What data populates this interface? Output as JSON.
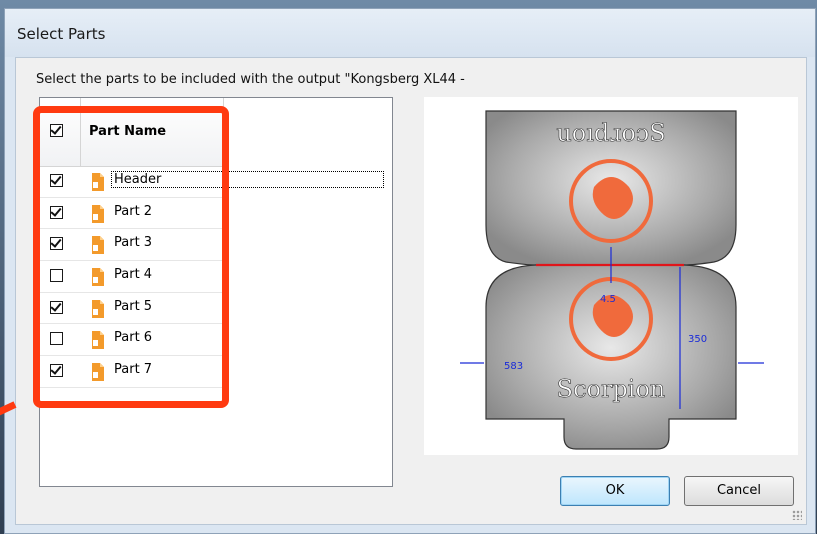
{
  "window": {
    "title": "Select Parts"
  },
  "instruction": "Select the parts to be included with the output \"Kongsberg  XL44 -",
  "list": {
    "header_checked": true,
    "column_header": "Part Name",
    "rows": [
      {
        "label": "Header",
        "checked": true,
        "focused": true
      },
      {
        "label": "Part 2",
        "checked": true
      },
      {
        "label": "Part 3",
        "checked": true
      },
      {
        "label": "Part 4",
        "checked": false
      },
      {
        "label": "Part 5",
        "checked": true
      },
      {
        "label": "Part 6",
        "checked": false
      },
      {
        "label": "Part 7",
        "checked": true
      }
    ]
  },
  "preview": {
    "top_logo_text": "uoıdɹoɔS",
    "bottom_logo_text": "Scorpion",
    "dimension_width": "583",
    "dimension_height": "350",
    "dimension_gap": "4.5"
  },
  "buttons": {
    "ok": "OK",
    "cancel": "Cancel"
  },
  "colors": {
    "highlight": "#ff3a10",
    "logo": "#f06a3c",
    "dimension": "#1a2bd8",
    "cutline": "#e0161b"
  },
  "icons": {
    "part": "document-orange-icon"
  }
}
